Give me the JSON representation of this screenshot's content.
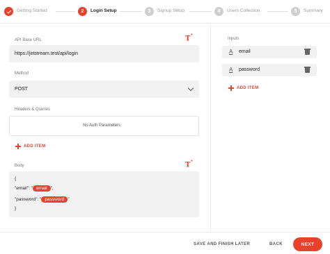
{
  "stepper": {
    "steps": [
      {
        "number": "",
        "label": "Getting Started",
        "state": "done"
      },
      {
        "number": "2",
        "label": "Login Setup",
        "state": "active"
      },
      {
        "number": "3",
        "label": "Signup Setup",
        "state": "todo"
      },
      {
        "number": "4",
        "label": "Users Collection",
        "state": "todo"
      },
      {
        "number": "5",
        "label": "Summary",
        "state": "todo"
      }
    ]
  },
  "form": {
    "api_base_url_label": "API Base URL",
    "api_base_url_value": "https://jetstream.test/api/login",
    "method_label": "Method",
    "method_value": "POST",
    "headers_label": "Headers & Queries",
    "headers_empty_text": "No Auth Parameters",
    "add_item_label": "ADD ITEM",
    "body_label": "Body",
    "body": {
      "open_brace": "{",
      "line1_key": "\"email\": \"",
      "line1_pill": "email",
      "line1_end": "\",",
      "line2_key": "\"password\": \"",
      "line2_pill": "password",
      "line2_end": "\"",
      "close_brace": "}"
    }
  },
  "inputs_panel": {
    "title": "Inputs",
    "items": [
      {
        "name": "email"
      },
      {
        "name": "password"
      }
    ],
    "add_item_label": "ADD ITEM"
  },
  "footer": {
    "save_later_label": "SAVE AND FINISH LATER",
    "back_label": "BACK",
    "next_label": "NEXT"
  },
  "colors": {
    "accent": "#e8412c",
    "field_bg": "#f2f2f2",
    "inactive_step": "#cfcfcf"
  }
}
